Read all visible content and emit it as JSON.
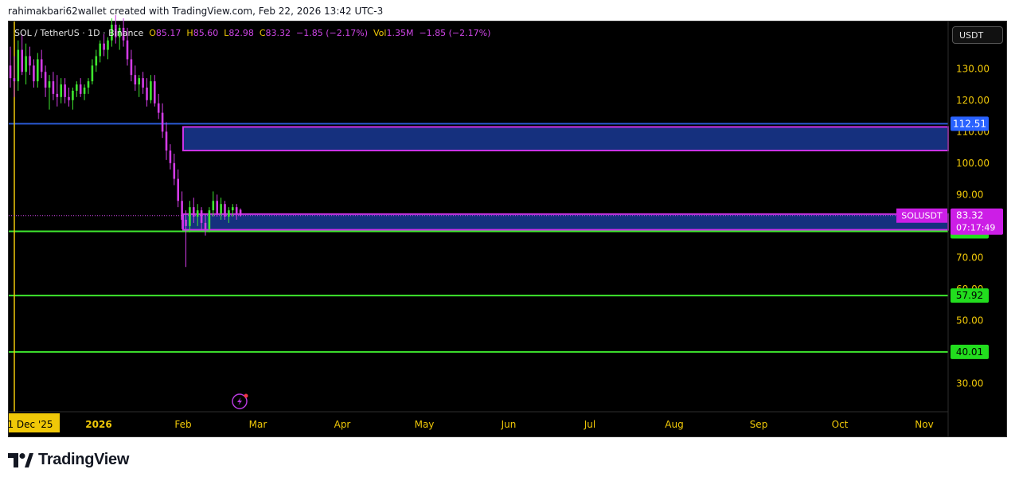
{
  "header": {
    "credit": "rahimakbari62wallet created with TradingView.com, Feb 22, 2026 13:42 UTC-3"
  },
  "legend": {
    "symbol_line": "SOL / TetherUS · 1D · Binance",
    "o_label": "O",
    "o_value": "85.17",
    "h_label": "H",
    "h_value": "85.60",
    "l_label": "L",
    "l_value": "82.98",
    "c_label": "C",
    "c_value": "83.32",
    "change": "−1.85 (−2.17%)",
    "vol_label": "Vol",
    "vol_value": "1.35M",
    "vol_change": "−1.85 (−2.17%)"
  },
  "unit_button": "USDT",
  "brand": {
    "name": "TradingView"
  },
  "colors": {
    "background": "#000000",
    "axis_text": "#f0c808",
    "up_candle": "#3ee62e",
    "down_candle": "#d33be6",
    "zone_fill": "#15307e",
    "zone_border": "#cc33e6",
    "support_line": "#3ee62e",
    "resistance_line": "#2a5bd7",
    "price_badge": "#cc1ee6",
    "event_icon": "#b93be0"
  },
  "chart_data": {
    "type": "candlestick",
    "symbol": "SOLUSDT",
    "ylim": [
      21,
      145
    ],
    "y_ticks": [
      "130.00",
      "120.00",
      "110.00",
      "100.00",
      "90.00",
      "80.00",
      "70.00",
      "60.00",
      "50.00",
      "40.00",
      "30.00"
    ],
    "x_ticks": [
      "1 Dec '25",
      "2026",
      "Feb",
      "Mar",
      "Apr",
      "May",
      "Jun",
      "Jul",
      "Aug",
      "Sep",
      "Oct",
      "Nov"
    ],
    "current_price": {
      "symbol_label": "SOLUSDT",
      "value": "83.32",
      "countdown": "07:17:49"
    },
    "horizontal_lines": [
      {
        "value": 112.51,
        "label": "112.51",
        "color": "blue"
      },
      {
        "value": 78.31,
        "label": "78.31",
        "color": "green"
      },
      {
        "value": 57.92,
        "label": "57.92",
        "color": "green"
      },
      {
        "value": 40.01,
        "label": "40.01",
        "color": "green"
      }
    ],
    "zones": [
      {
        "top": 111.5,
        "bottom": 104
      },
      {
        "top": 83.8,
        "bottom": 78.8
      }
    ],
    "candles": [
      {
        "o": 131,
        "h": 137,
        "l": 124,
        "c": 127
      },
      {
        "o": 127,
        "h": 134,
        "l": 121,
        "c": 126
      },
      {
        "o": 126,
        "h": 139,
        "l": 123,
        "c": 136
      },
      {
        "o": 136,
        "h": 141,
        "l": 128,
        "c": 129
      },
      {
        "o": 129,
        "h": 138,
        "l": 125,
        "c": 134
      },
      {
        "o": 134,
        "h": 137,
        "l": 128,
        "c": 131
      },
      {
        "o": 131,
        "h": 133,
        "l": 124,
        "c": 126
      },
      {
        "o": 126,
        "h": 135,
        "l": 124,
        "c": 133
      },
      {
        "o": 133,
        "h": 136,
        "l": 127,
        "c": 129
      },
      {
        "o": 129,
        "h": 131,
        "l": 121,
        "c": 124
      },
      {
        "o": 124,
        "h": 128,
        "l": 117,
        "c": 126
      },
      {
        "o": 126,
        "h": 129,
        "l": 120,
        "c": 122
      },
      {
        "o": 122,
        "h": 128,
        "l": 118,
        "c": 121
      },
      {
        "o": 121,
        "h": 127,
        "l": 119,
        "c": 125
      },
      {
        "o": 125,
        "h": 127,
        "l": 119,
        "c": 121
      },
      {
        "o": 121,
        "h": 124,
        "l": 118,
        "c": 120
      },
      {
        "o": 120,
        "h": 124,
        "l": 117,
        "c": 123
      },
      {
        "o": 123,
        "h": 126,
        "l": 121,
        "c": 125
      },
      {
        "o": 125,
        "h": 127,
        "l": 121,
        "c": 122
      },
      {
        "o": 122,
        "h": 125,
        "l": 120,
        "c": 124
      },
      {
        "o": 124,
        "h": 127,
        "l": 122,
        "c": 126
      },
      {
        "o": 126,
        "h": 133,
        "l": 125,
        "c": 131
      },
      {
        "o": 131,
        "h": 136,
        "l": 129,
        "c": 134
      },
      {
        "o": 134,
        "h": 139,
        "l": 132,
        "c": 138
      },
      {
        "o": 138,
        "h": 141,
        "l": 134,
        "c": 136
      },
      {
        "o": 136,
        "h": 140,
        "l": 133,
        "c": 139
      },
      {
        "o": 139,
        "h": 146,
        "l": 137,
        "c": 144
      },
      {
        "o": 144,
        "h": 147,
        "l": 138,
        "c": 140
      },
      {
        "o": 140,
        "h": 144,
        "l": 136,
        "c": 143
      },
      {
        "o": 143,
        "h": 146,
        "l": 137,
        "c": 139
      },
      {
        "o": 139,
        "h": 143,
        "l": 131,
        "c": 133
      },
      {
        "o": 133,
        "h": 136,
        "l": 126,
        "c": 128
      },
      {
        "o": 128,
        "h": 131,
        "l": 123,
        "c": 125
      },
      {
        "o": 125,
        "h": 128,
        "l": 121,
        "c": 127
      },
      {
        "o": 127,
        "h": 129,
        "l": 122,
        "c": 124
      },
      {
        "o": 124,
        "h": 127,
        "l": 118,
        "c": 120
      },
      {
        "o": 120,
        "h": 128,
        "l": 119,
        "c": 126
      },
      {
        "o": 126,
        "h": 128,
        "l": 118,
        "c": 119
      },
      {
        "o": 119,
        "h": 122,
        "l": 114,
        "c": 116
      },
      {
        "o": 116,
        "h": 119,
        "l": 108,
        "c": 110
      },
      {
        "o": 110,
        "h": 113,
        "l": 101,
        "c": 104
      },
      {
        "o": 104,
        "h": 106,
        "l": 98,
        "c": 100
      },
      {
        "o": 100,
        "h": 103,
        "l": 93,
        "c": 95
      },
      {
        "o": 95,
        "h": 98,
        "l": 86,
        "c": 88
      },
      {
        "o": 88,
        "h": 91,
        "l": 79,
        "c": 82
      },
      {
        "o": 82,
        "h": 85,
        "l": 67,
        "c": 80
      },
      {
        "o": 80,
        "h": 88,
        "l": 78,
        "c": 86
      },
      {
        "o": 86,
        "h": 89,
        "l": 81,
        "c": 83
      },
      {
        "o": 83,
        "h": 87,
        "l": 80,
        "c": 85
      },
      {
        "o": 85,
        "h": 86,
        "l": 79,
        "c": 81
      },
      {
        "o": 81,
        "h": 84,
        "l": 77,
        "c": 79
      },
      {
        "o": 79,
        "h": 86,
        "l": 78,
        "c": 85
      },
      {
        "o": 85,
        "h": 91,
        "l": 83,
        "c": 88
      },
      {
        "o": 88,
        "h": 90,
        "l": 83,
        "c": 84
      },
      {
        "o": 84,
        "h": 89,
        "l": 82,
        "c": 87
      },
      {
        "o": 87,
        "h": 88,
        "l": 82,
        "c": 83
      },
      {
        "o": 83,
        "h": 86,
        "l": 81,
        "c": 85
      },
      {
        "o": 85,
        "h": 87,
        "l": 83,
        "c": 86
      },
      {
        "o": 86,
        "h": 87,
        "l": 82,
        "c": 84
      },
      {
        "o": 85.17,
        "h": 85.6,
        "l": 82.98,
        "c": 83.32
      }
    ]
  }
}
